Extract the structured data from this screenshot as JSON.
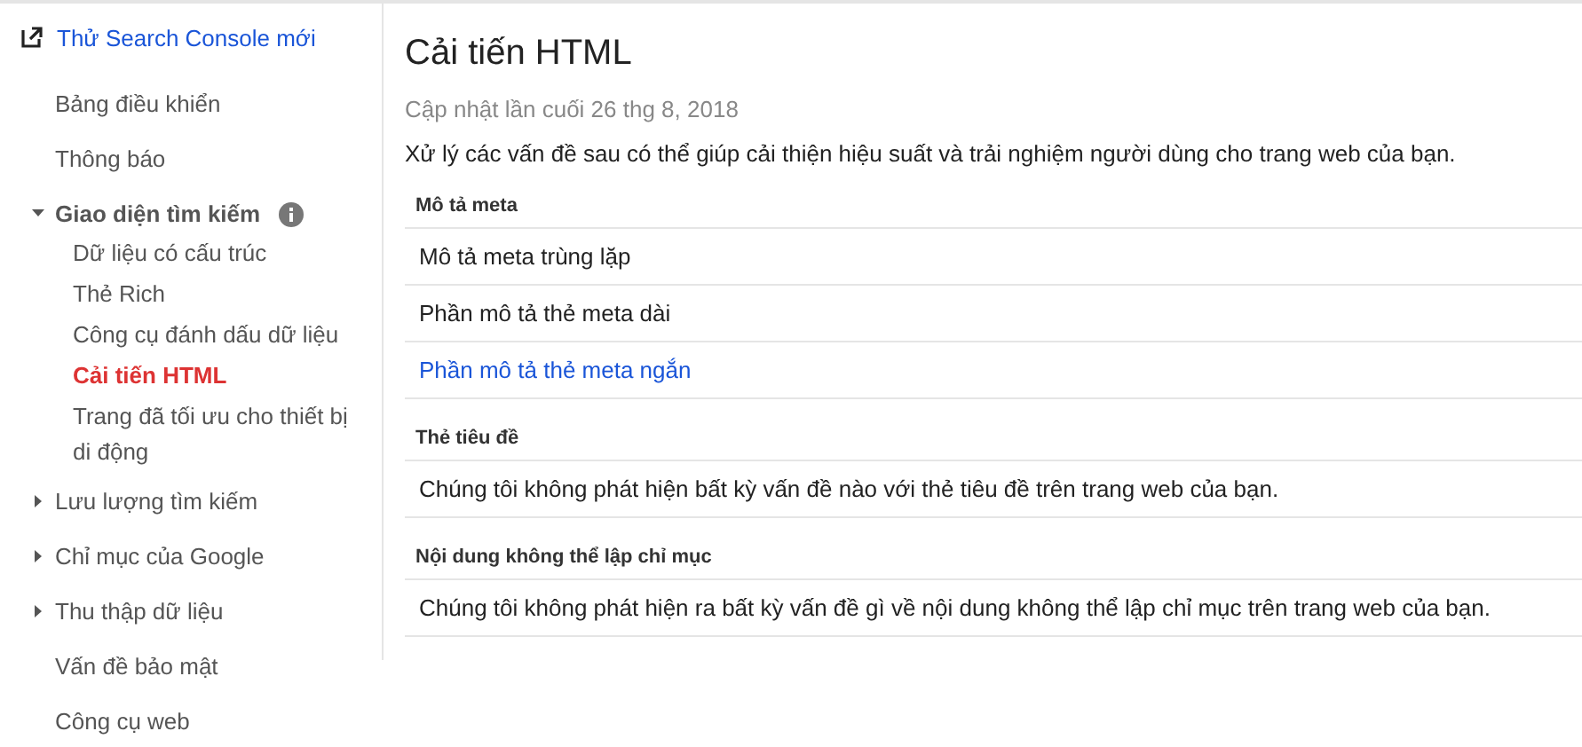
{
  "sidebar": {
    "link": "Thử Search Console mới",
    "items": [
      {
        "label": "Bảng điều khiển",
        "selected": false
      },
      {
        "label": "Thông báo",
        "selected": false
      },
      {
        "label": "Giao diện tìm kiếm",
        "selected": false,
        "expanded": true,
        "info": true,
        "children": [
          {
            "label": "Dữ liệu có cấu trúc",
            "selected": false
          },
          {
            "label": "Thẻ Rich",
            "selected": false
          },
          {
            "label": "Công cụ đánh dấu dữ liệu",
            "selected": false
          },
          {
            "label": "Cải tiến HTML",
            "selected": true
          },
          {
            "label": "Trang đã tối ưu cho thiết bị di động",
            "selected": false
          }
        ]
      },
      {
        "label": "Lưu lượng tìm kiếm",
        "selected": false,
        "expanded": false
      },
      {
        "label": "Chỉ mục của Google",
        "selected": false,
        "expanded": false
      },
      {
        "label": "Thu thập dữ liệu",
        "selected": false,
        "expanded": false
      },
      {
        "label": "Vấn đề bảo mật",
        "selected": false
      },
      {
        "label": "Công cụ web",
        "selected": false
      }
    ]
  },
  "main": {
    "title": "Cải tiến HTML",
    "updated": "Cập nhật lần cuối 26 thg 8, 2018",
    "description": "Xử lý các vấn đề sau có thể giúp cải thiện hiệu suất và trải nghiệm người dùng cho trang web của bạn.",
    "sections": [
      {
        "heading": "Mô tả meta",
        "rows": [
          {
            "text": "Mô tả meta trùng lặp",
            "kind": "text"
          },
          {
            "text": "Phần mô tả thẻ meta dài",
            "kind": "text"
          },
          {
            "text": "Phần mô tả thẻ meta ngắn",
            "kind": "link"
          }
        ]
      },
      {
        "heading": "Thẻ tiêu đề",
        "rows": [
          {
            "text": "Chúng tôi không phát hiện bất kỳ vấn đề nào với thẻ tiêu đề trên trang web của bạn.",
            "kind": "text"
          }
        ]
      },
      {
        "heading": "Nội dung không thể lập chỉ mục",
        "rows": [
          {
            "text": "Chúng tôi không phát hiện ra bất kỳ vấn đề gì về nội dung không thể lập chỉ mục trên trang web của bạn.",
            "kind": "text"
          }
        ]
      }
    ]
  }
}
